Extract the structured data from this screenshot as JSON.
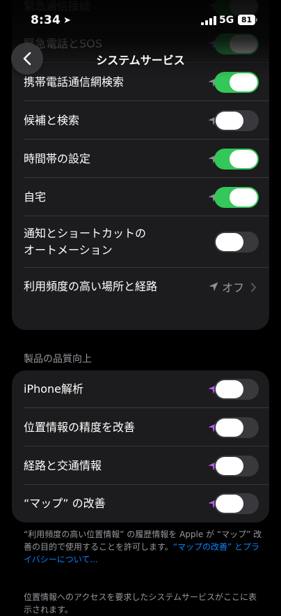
{
  "status_bar": {
    "time": "8:34",
    "carrier": "5G",
    "battery": "81"
  },
  "header": {
    "title": "システムサービス"
  },
  "colors": {
    "toggle_on": "#34c759",
    "toggle_off": "#39393d",
    "location_recent": "#bf5af2",
    "location_gray": "#8e8e93",
    "link": "#0a84ff"
  },
  "card1": {
    "rows": [
      {
        "label": "緊急通信接続",
        "icon": "location-purple",
        "toggle": true
      },
      {
        "label": "緊急電話とSOS",
        "icon": "location-purple",
        "toggle": true
      },
      {
        "label": "携帯電話通信網検索",
        "icon": "location-gray",
        "toggle": true
      },
      {
        "label": "候補と検索",
        "icon": "location-gray",
        "toggle": false
      },
      {
        "label": "時間帯の設定",
        "icon": "location-gray",
        "toggle": true
      },
      {
        "label": "自宅",
        "icon": "location-gray",
        "toggle": true
      },
      {
        "label": "通知とショートカットの\nオートメーション",
        "icon": "none",
        "toggle": false
      },
      {
        "label": "利用頻度の高い場所と経路",
        "icon": "location-gray",
        "value": "オフ"
      }
    ]
  },
  "section2": {
    "header": "製品の品質向上",
    "rows": [
      {
        "label": "iPhone解析",
        "icon": "location-purple",
        "toggle": false
      },
      {
        "label": "位置情報の精度を改善",
        "icon": "location-purple",
        "toggle": false
      },
      {
        "label": "経路と交通情報",
        "icon": "location-purple",
        "toggle": false
      },
      {
        "label": "“マップ” の改善",
        "icon": "location-purple",
        "toggle": false
      }
    ],
    "footer_text": "“利用頻度の高い位置情報” の履歴情報を Apple が “マップ” 改善の目的で使用することを許可します。",
    "footer_link": "“マップの改善” とプライバシーについて..."
  },
  "footer2": "位置情報へのアクセスを要求したシステムサービスがここに表示されます。"
}
